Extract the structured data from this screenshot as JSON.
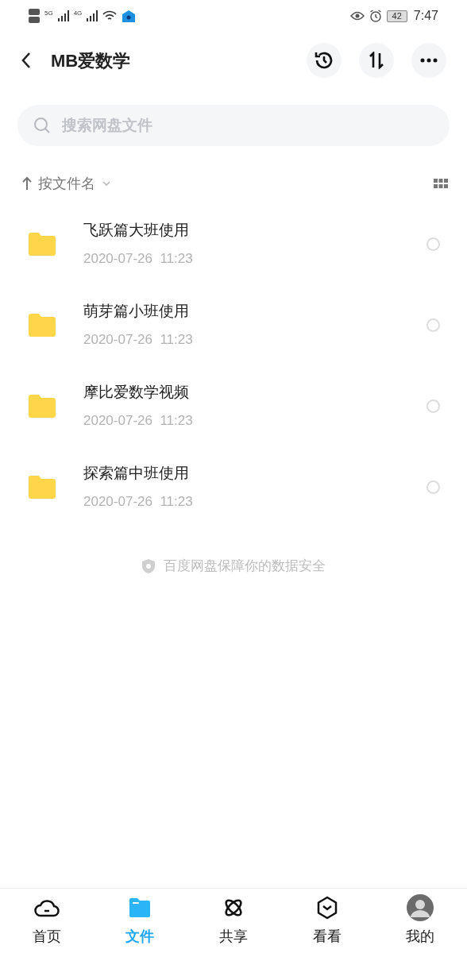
{
  "status_bar": {
    "network_1": "5G",
    "network_2": "4G",
    "battery": "42",
    "time": "7:47"
  },
  "header": {
    "title": "MB爱数学"
  },
  "search": {
    "placeholder": "搜索网盘文件"
  },
  "sort": {
    "label": "按文件名"
  },
  "files": [
    {
      "name": "飞跃篇大班使用",
      "date": "2020-07-26  11:23",
      "selected": false
    },
    {
      "name": "萌芽篇小班使用",
      "date": "2020-07-26  11:23",
      "selected": false
    },
    {
      "name": "摩比爱数学视频",
      "date": "2020-07-26  11:23",
      "selected": false
    },
    {
      "name": "探索篇中班使用",
      "date": "2020-07-26  11:23",
      "selected": false
    }
  ],
  "footer_note": "百度网盘保障你的数据安全",
  "tabs": [
    {
      "label": "首页",
      "kind": "cloud",
      "selected": false
    },
    {
      "label": "文件",
      "kind": "folder",
      "selected": true
    },
    {
      "label": "共享",
      "kind": "orbit",
      "selected": false
    },
    {
      "label": "看看",
      "kind": "hexagon",
      "selected": false
    },
    {
      "label": "我的",
      "kind": "avatar",
      "selected": false
    }
  ]
}
